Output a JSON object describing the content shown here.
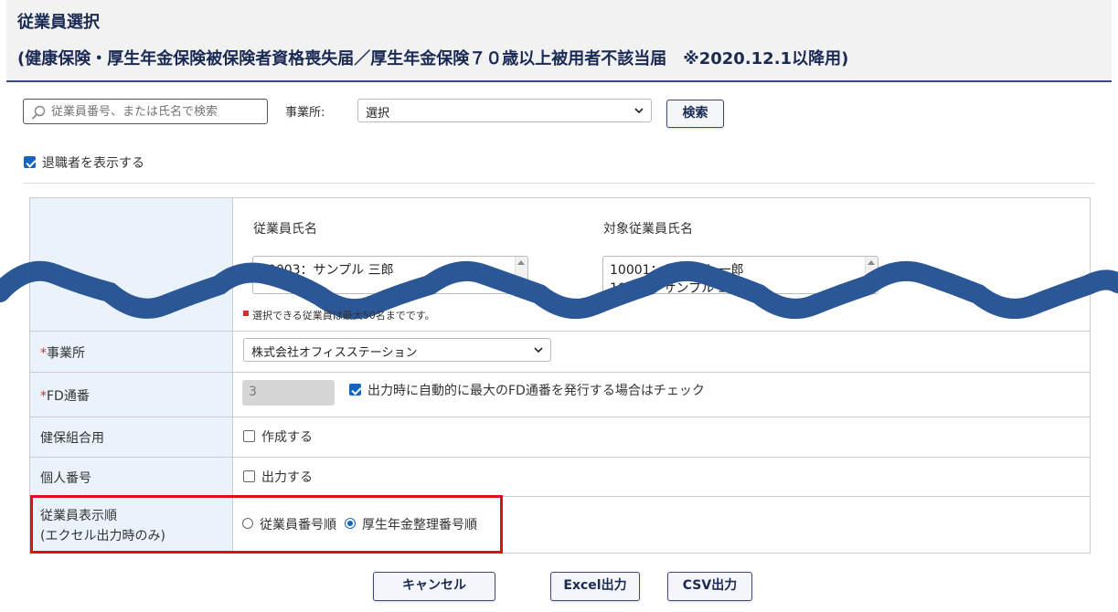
{
  "header": {
    "title": "従業員選択",
    "subtitle": "(健康保険・厚生年金保険被保険者資格喪失届／厚生年金保険７０歳以上被用者不該当届　※2020.12.1以降用)"
  },
  "search": {
    "placeholder": "従業員番号、または氏名で検索",
    "office_label": "事業所:",
    "office_value": "選択",
    "button": "検索"
  },
  "show_retired": {
    "label": "退職者を表示する",
    "checked": true
  },
  "employee_lists": {
    "left_header": "従業員氏名",
    "left_items": [
      "10003：サンプル 三郎"
    ],
    "right_header": "対象従業員氏名",
    "right_items": [
      "10001：サンプル 一郎",
      "10002：サンプル 二郎"
    ],
    "note": "選択できる従業員は最大50名までです。"
  },
  "form": {
    "office": {
      "label": "事業所",
      "value": "株式会社オフィスステーション"
    },
    "fd_number": {
      "label": "FD通番",
      "value": "3",
      "auto_label": "出力時に自動的に最大のFD通番を発行する場合はチェック",
      "auto_checked": true
    },
    "kenpo": {
      "label": "健保組合用",
      "option": "作成する",
      "checked": false
    },
    "my_number": {
      "label": "個人番号",
      "option": "出力する",
      "checked": false
    },
    "order": {
      "label_line1": "従業員表示順",
      "label_line2": "(エクセル出力時のみ)",
      "options": [
        "従業員番号順",
        "厚生年金整理番号順"
      ],
      "selected": "厚生年金整理番号順"
    }
  },
  "buttons": {
    "cancel": "キャンセル",
    "excel": "Excel出力",
    "csv": "CSV出力"
  },
  "colors": {
    "accent": "#1565c0",
    "header_text": "#1a2a55",
    "label_bg": "#eaf3fb",
    "highlight": "#e01010",
    "wave": "#2b5797"
  }
}
